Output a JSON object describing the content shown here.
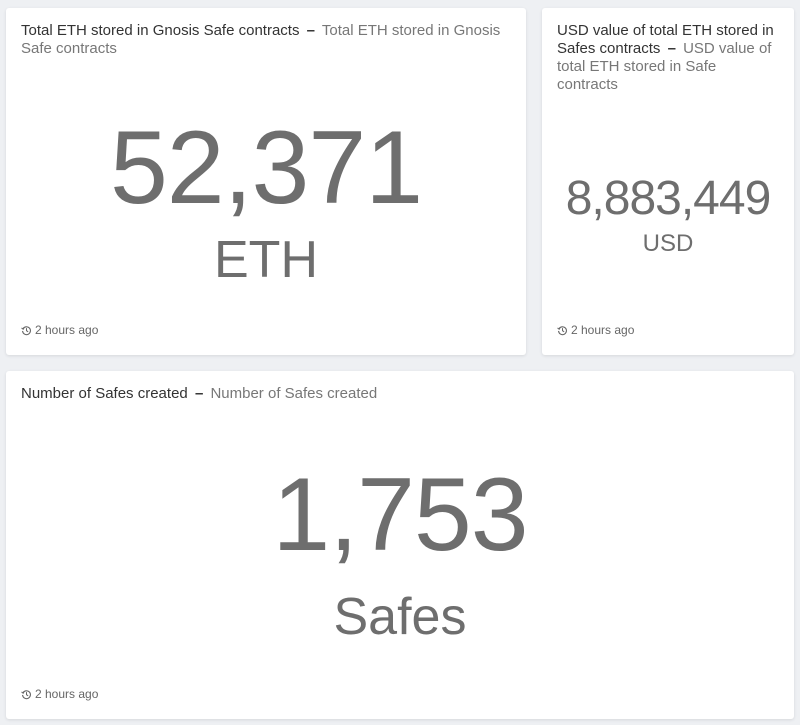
{
  "widgets": [
    {
      "title": "Total ETH stored in Gnosis Safe contracts",
      "separator": "–",
      "description": "Total ETH stored in Gnosis Safe contracts",
      "value": "52,371",
      "unit": "ETH",
      "updated": "2 hours ago"
    },
    {
      "title": "USD value of total ETH stored in Safes contracts",
      "separator": "–",
      "description": "USD value of total ETH stored in Safe contracts",
      "value": "8,883,449",
      "unit": "USD",
      "updated": "2 hours ago"
    },
    {
      "title": "Number of Safes created",
      "separator": "–",
      "description": "Number of Safes created",
      "value": "1,753",
      "unit": "Safes",
      "updated": "2 hours ago"
    }
  ],
  "icons": {
    "refresh": "history-icon"
  },
  "colors": {
    "value_text": "#6e6e6e",
    "card_background": "#ffffff",
    "page_background": "#eef0f3"
  }
}
